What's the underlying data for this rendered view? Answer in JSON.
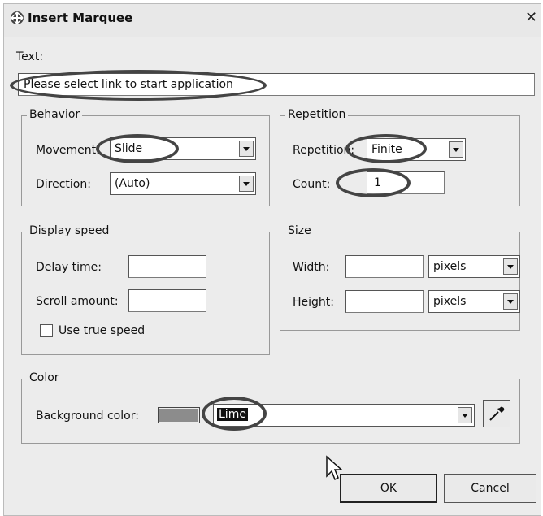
{
  "title": "Insert Marquee",
  "text_label": "Text:",
  "text_value": "Please select link to start application",
  "behavior": {
    "legend": "Behavior",
    "movement_label": "Movement:",
    "movement_value": "Slide",
    "direction_label": "Direction:",
    "direction_value": "(Auto)"
  },
  "repetition": {
    "legend": "Repetition",
    "repetition_label": "Repetition:",
    "repetition_value": "Finite",
    "count_label": "Count:",
    "count_value": "1"
  },
  "display_speed": {
    "legend": "Display speed",
    "delay_label": "Delay time:",
    "delay_value": "",
    "scroll_label": "Scroll amount:",
    "scroll_value": "",
    "true_speed_label": "Use true speed",
    "true_speed_checked": false
  },
  "size": {
    "legend": "Size",
    "width_label": "Width:",
    "width_value": "",
    "width_unit": "pixels",
    "height_label": "Height:",
    "height_value": "",
    "height_unit": "pixels"
  },
  "color": {
    "legend": "Color",
    "bg_label": "Background color:",
    "bg_value": "Lime",
    "swatch_color": "#8c8c8c"
  },
  "buttons": {
    "ok": "OK",
    "cancel": "Cancel"
  }
}
